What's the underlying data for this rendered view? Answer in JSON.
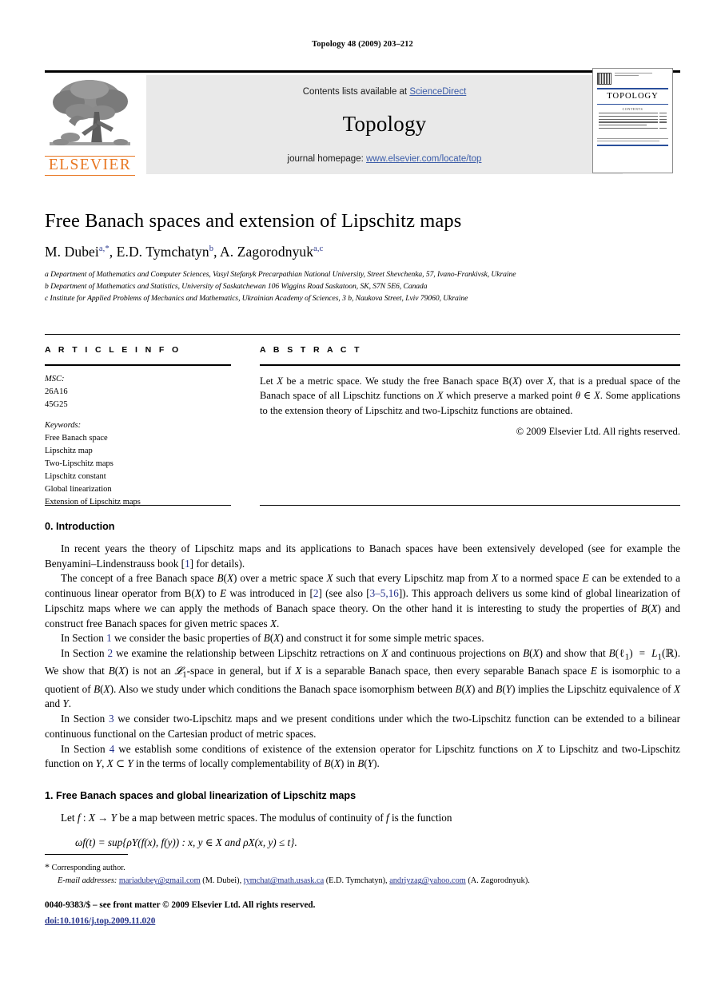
{
  "running_head": "Topology 48 (2009) 203–212",
  "masthead": {
    "publisher_name": "ELSEVIER",
    "contents_prefix": "Contents lists available at ",
    "contents_link": "ScienceDirect",
    "journal_title": "Topology",
    "homepage_prefix": "journal homepage: ",
    "homepage_link": "www.elsevier.com/locate/top",
    "cover": {
      "title": "TOPOLOGY",
      "contents_label": "CONTENTS"
    }
  },
  "article": {
    "title": "Free Banach spaces and extension of Lipschitz maps",
    "authors": "M. Dubei a,*, E.D. Tymchatyn b, A. Zagorodnyuk a,c",
    "affiliations": [
      "a Department of Mathematics and Computer Sciences, Vasyl Stefanyk Precarpathian National University, Street Shevchenka, 57, Ivano-Frankivsk, Ukraine",
      "b Department of Mathematics and Statistics, University of Saskatchewan 106 Wiggins Road Saskatoon, SK, S7N 5E6, Canada",
      "c Institute for Applied Problems of Mechanics and Mathematics, Ukrainian Academy of Sciences, 3 b, Naukova Street, Lviv 79060, Ukraine"
    ]
  },
  "article_info": {
    "heading": "A R T I C L E   I N F O",
    "msc_label": "MSC:",
    "msc_codes": [
      "26A16",
      "45G25"
    ],
    "keywords_label": "Keywords:",
    "keywords": [
      "Free Banach space",
      "Lipschitz map",
      "Two-Lipschitz maps",
      "Lipschitz constant",
      "Global linearization",
      "Extension of Lipschitz maps"
    ]
  },
  "abstract": {
    "heading": "A B S T R A C T",
    "text": "Let X be a metric space. We study the free Banach space B(X) over X, that is a predual space of the Banach space of all Lipschitz functions on X which preserve a marked point θ ∈ X. Some applications to the extension theory of Lipschitz and two-Lipschitz functions are obtained.",
    "copyright": "© 2009 Elsevier Ltd. All rights reserved."
  },
  "body": {
    "section0_heading": "0. Introduction",
    "paragraphs": [
      "In recent years the theory of Lipschitz maps and its applications to Banach spaces have been extensively developed (see for example the Benyamini–Lindenstrauss book [1] for details).",
      "The concept of a free Banach space B(X) over a metric space X such that every Lipschitz map from X to a normed space E can be extended to a continuous linear operator from B(X) to E was introduced in [2] (see also [3–5,16]). This approach delivers us some kind of global linearization of Lipschitz maps where we can apply the methods of Banach space theory. On the other hand it is interesting to study the properties of B(X) and construct free Banach spaces for given metric spaces X.",
      "In Section 1 we consider the basic properties of B(X) and construct it for some simple metric spaces.",
      "In Section 2 we examine the relationship between Lipschitz retractions on X and continuous projections on B(X) and show that B(ℓ1) = L1(ℝ). We show that B(X) is not an L1-space in general, but if X is a separable Banach space, then every separable Banach space E is isomorphic to a quotient of B(X). Also we study under which conditions the Banach space isomorphism between B(X) and B(Y) implies the Lipschitz equivalence of X and Y.",
      "In Section 3 we consider two-Lipschitz maps and we present conditions under which the two-Lipschitz function can be extended to a bilinear continuous functional on the Cartesian product of metric spaces.",
      "In Section 4 we establish some conditions of existence of the extension operator for Lipschitz functions on X to Lipschitz and two-Lipschitz function on Y, X ⊂ Y in the terms of locally complementability of B(X) in B(Y)."
    ],
    "section1_heading": "1. Free Banach spaces and global linearization of Lipschitz maps",
    "section1_paragraph": "Let f : X → Y be a map between metric spaces. The modulus of continuity of f is the function",
    "equation": "ωf(t) = sup{ρY(f(x), f(y))  :  x, y ∈ X and ρX(x, y) ≤ t}."
  },
  "footnotes": {
    "corresponding": "* Corresponding author.",
    "email_label": "E-mail addresses:",
    "emails": [
      {
        "address": "mariadubey@gmail.com",
        "owner": "(M. Dubei)"
      },
      {
        "address": "tymchat@math.usask.ca",
        "owner": "(E.D. Tymchatyn)"
      },
      {
        "address": "andriyzag@yahoo.com",
        "owner": "(A. Zagorodnyuk)."
      }
    ],
    "email_line": "E-mail addresses: mariadubey@gmail.com (M. Dubei), tymchat@math.usask.ca (E.D. Tymchatyn), andriyzag@yahoo.com (A. Zagorodnyuk)."
  },
  "colophon": {
    "front_matter": "0040-9383/$ – see front matter © 2009 Elsevier Ltd. All rights reserved.",
    "doi": "doi:10.1016/j.top.2009.11.020"
  },
  "colors": {
    "link": "#27348b",
    "sciencedirect": "#3b5ca8",
    "elsevier_orange": "#e87722",
    "band_gray": "#e9e9e9"
  }
}
